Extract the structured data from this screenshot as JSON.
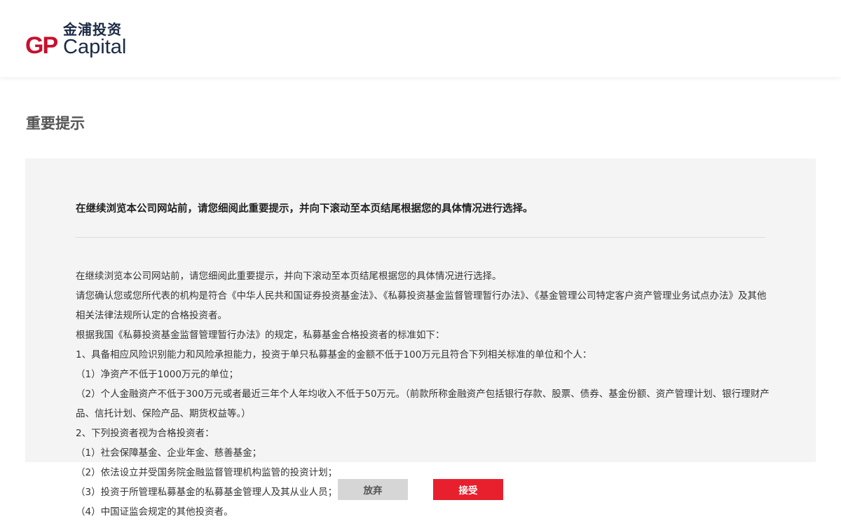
{
  "header": {
    "logo_cn": "金浦投资",
    "logo_mark": "GP",
    "logo_en": "Capital"
  },
  "page_title": "重要提示",
  "notice": {
    "heading": "在继续浏览本公司网站前，请您细阅此重要提示，并向下滚动至本页结尾根据您的具体情况进行选择。",
    "paragraphs": [
      "在继续浏览本公司网站前，请您细阅此重要提示，并向下滚动至本页结尾根据您的具体情况进行选择。",
      "请您确认您或您所代表的机构是符合《中华人民共和国证券投资基金法》、《私募投资基金监督管理暂行办法》、《基金管理公司特定客户资产管理业务试点办法》及其他相关法律法规所认定的合格投资者。",
      "根据我国《私募投资基金监督管理暂行办法》的规定，私募基金合格投资者的标准如下：",
      "1、具备相应风险识别能力和风险承担能力，投资于单只私募基金的金额不低于100万元且符合下列相关标准的单位和个人：",
      "（1）净资产不低于1000万元的单位；",
      "（2）个人金融资产不低于300万元或者最近三年个人年均收入不低于50万元。（前款所称金融资产包括银行存款、股票、债券、基金份额、资产管理计划、银行理财产品、信托计划、保险产品、期货权益等。）",
      "2、下列投资者视为合格投资者：",
      "（1）社会保障基金、企业年金、慈善基金；",
      "（2）依法设立并受国务院金融监督管理机构监管的投资计划；",
      "（3）投资于所管理私募基金的私募基金管理人及其从业人员；",
      "（4）中国证监会规定的其他投资者。"
    ]
  },
  "buttons": {
    "decline": "放弃",
    "accept": "接受"
  },
  "colors": {
    "brand_red": "#c8102e",
    "accept_button": "#e8202e",
    "decline_button": "#d6d6d6",
    "panel_background": "#f4f4f4",
    "logo_navy": "#1a2a44"
  }
}
